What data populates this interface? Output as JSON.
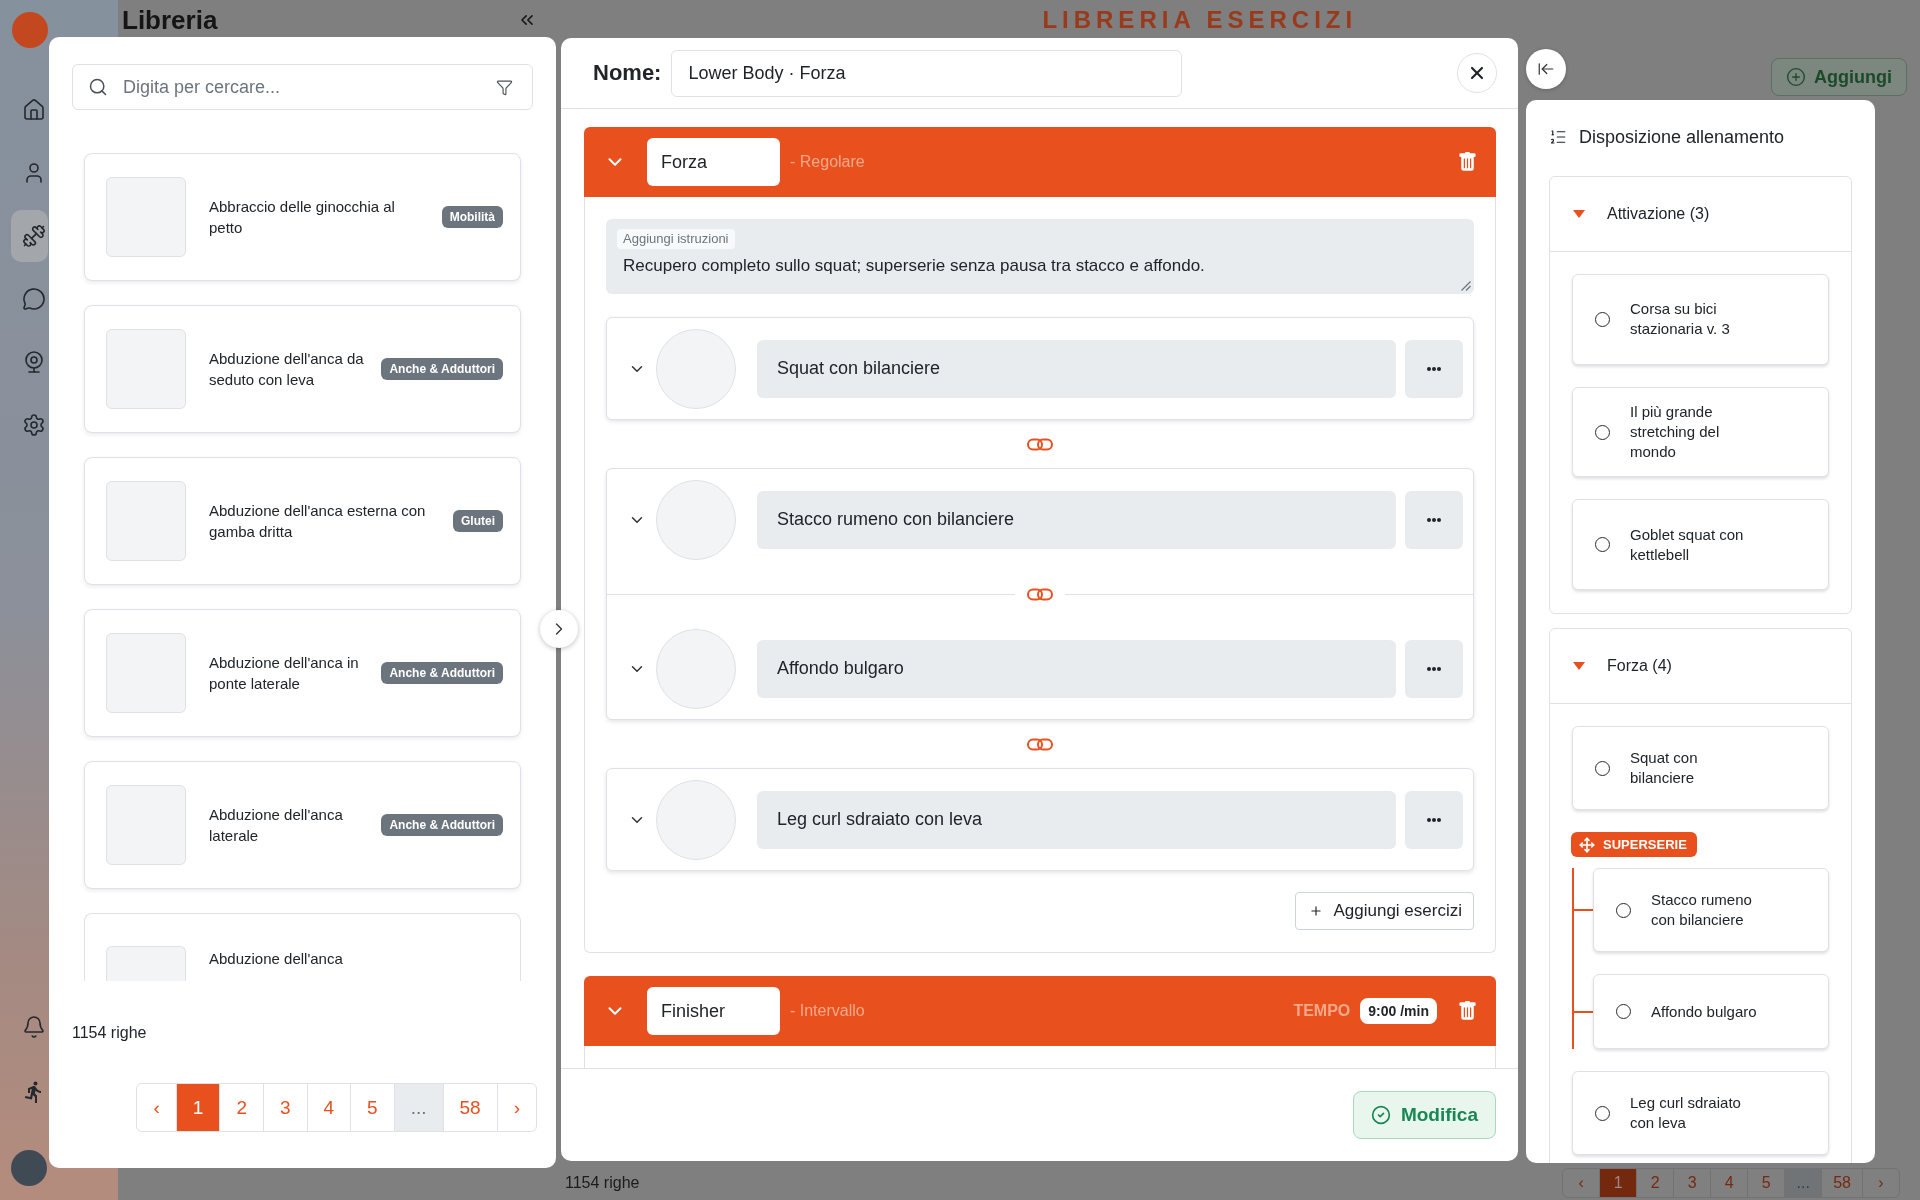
{
  "sidebar": {
    "items": [
      {
        "selected": false
      },
      {
        "selected": false
      },
      {
        "selected": true
      },
      {
        "selected": false
      },
      {
        "selected": false
      },
      {
        "selected": false
      }
    ],
    "bottom_items": [
      {
        "selected": false
      },
      {
        "selected": false
      }
    ]
  },
  "page": {
    "title": "Libreria",
    "banner": "LIBRERIA ESERCIZI",
    "add_button": "Aggiungi",
    "row_count": "1154 righe",
    "pagination": [
      {
        "label": "‹",
        "selected": false,
        "disabled": false
      },
      {
        "label": "1",
        "selected": true,
        "disabled": false
      },
      {
        "label": "2",
        "selected": false,
        "disabled": false
      },
      {
        "label": "3",
        "selected": false,
        "disabled": false
      },
      {
        "label": "4",
        "selected": false,
        "disabled": false
      },
      {
        "label": "5",
        "selected": false,
        "disabled": false
      },
      {
        "label": "...",
        "selected": false,
        "disabled": true
      },
      {
        "label": "58",
        "selected": false,
        "disabled": false
      },
      {
        "label": "›",
        "selected": false,
        "disabled": false
      }
    ]
  },
  "library": {
    "search": {
      "placeholder": "Digita per cercare..."
    },
    "exercises": [
      {
        "name": "Abbraccio delle ginocchia al petto",
        "tag": "Mobilità"
      },
      {
        "name": "Abduzione dell'anca da seduto con leva",
        "tag": "Anche & Adduttori"
      },
      {
        "name": "Abduzione dell'anca esterna con gamba dritta",
        "tag": "Glutei"
      },
      {
        "name": "Abduzione dell'anca in ponte laterale",
        "tag": "Anche & Adduttori"
      },
      {
        "name": "Abduzione dell'anca laterale",
        "tag": "Anche & Adduttori"
      },
      {
        "name": "Abduzione dell'anca"
      }
    ],
    "row_count": "1154 righe",
    "pagination": [
      {
        "label": "‹",
        "selected": false,
        "disabled": false
      },
      {
        "label": "1",
        "selected": true,
        "disabled": false
      },
      {
        "label": "2",
        "selected": false,
        "disabled": false
      },
      {
        "label": "3",
        "selected": false,
        "disabled": false
      },
      {
        "label": "4",
        "selected": false,
        "disabled": false
      },
      {
        "label": "5",
        "selected": false,
        "disabled": false
      },
      {
        "label": "...",
        "selected": false,
        "disabled": true
      },
      {
        "label": "58",
        "selected": false,
        "disabled": false
      },
      {
        "label": "›",
        "selected": false,
        "disabled": false
      }
    ]
  },
  "editor": {
    "name_label": "Nome:",
    "name": "Lower Body · Forza",
    "sections": [
      {
        "name": "Forza",
        "type": "- Regolare",
        "expanded": true,
        "instructions_label": "Aggiungi istruzioni",
        "instructions": "Recupero completo sullo squat; superserie senza pausa tra stacco e affondo.",
        "blocks": [
          {
            "kind": "single",
            "exercises": [
              {
                "name": "Squat con bilanciere"
              }
            ]
          },
          {
            "kind": "superset",
            "exercises": [
              {
                "name": "Stacco rumeno con bilanciere"
              },
              {
                "name": "Affondo bulgaro"
              }
            ]
          },
          {
            "kind": "single",
            "exercises": [
              {
                "name": "Leg curl sdraiato con leva"
              }
            ]
          }
        ],
        "add_button": "Aggiungi esercizi"
      },
      {
        "name": "Finisher",
        "type": "- Intervallo",
        "expanded": true,
        "time_label": "TEMPO",
        "time": "9:00 /min"
      }
    ],
    "save_button": "Modifica"
  },
  "layout_panel": {
    "title": "Disposizione allenamento",
    "groups": [
      {
        "title": "Attivazione (3)",
        "expanded": true,
        "items": [
          {
            "kind": "exercise",
            "name": "Corsa su bici stazionaria v. 3",
            "checked": false
          },
          {
            "kind": "exercise",
            "name": "Il più grande stretching del mondo",
            "checked": false
          },
          {
            "kind": "exercise",
            "name": "Goblet squat con kettlebell",
            "checked": false
          }
        ]
      },
      {
        "title": "Forza (4)",
        "expanded": true,
        "items": [
          {
            "kind": "exercise",
            "name": "Squat con bilanciere",
            "checked": false
          },
          {
            "kind": "superset",
            "label": "SUPERSERIE",
            "children": [
              {
                "name": "Stacco rumeno con bilanciere",
                "checked": false
              },
              {
                "name": "Affondo bulgaro",
                "checked": false
              }
            ]
          },
          {
            "kind": "exercise",
            "name": "Leg curl sdraiato con leva",
            "checked": false
          }
        ]
      }
    ]
  }
}
